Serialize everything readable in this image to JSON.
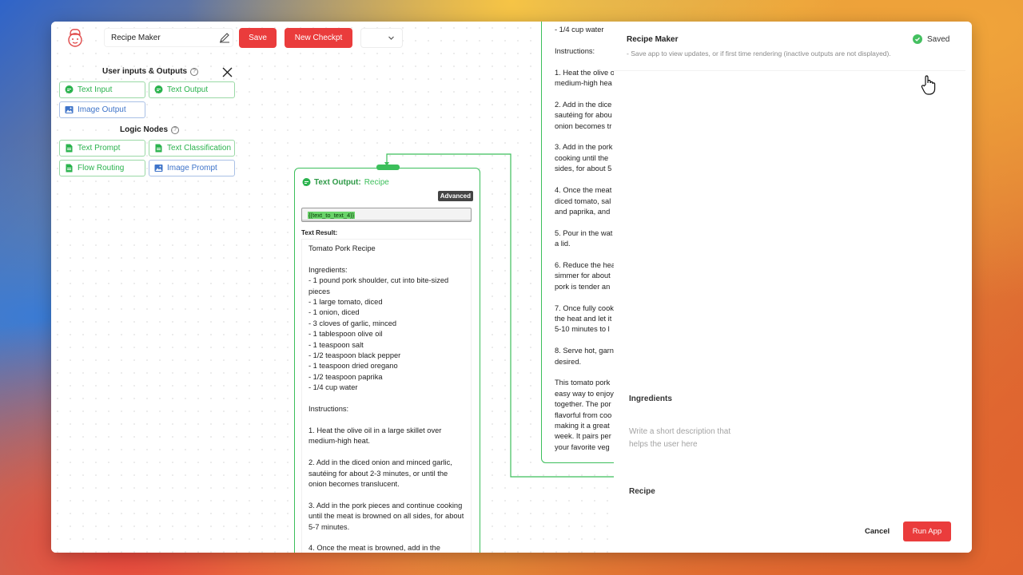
{
  "colors": {
    "accent_red": "#ea3c3c",
    "node_green": "#3cbf5b",
    "chip_green": "#2bb34e",
    "chip_blue": "#3f74c9"
  },
  "toolbar": {
    "app_name_value": "Recipe Maker",
    "save_label": "Save",
    "new_checkpoint_label": "New Checkpt",
    "dropdown_value": ""
  },
  "palette": {
    "io_title": "User inputs & Outputs",
    "io_items": [
      {
        "label": "Text Input",
        "icon": "chat-bubble-icon"
      },
      {
        "label": "Text Output",
        "icon": "chat-bubble-icon"
      },
      {
        "label": "Image Output",
        "icon": "image-icon"
      }
    ],
    "logic_title": "Logic Nodes",
    "logic_items": [
      {
        "label": "Text Prompt",
        "icon": "document-icon"
      },
      {
        "label": "Text Classification",
        "icon": "document-icon"
      },
      {
        "label": "Flow Routing",
        "icon": "document-icon"
      },
      {
        "label": "Image Prompt",
        "icon": "image-icon"
      }
    ]
  },
  "node": {
    "title": "Text Output:",
    "subtitle": "Recipe",
    "advanced_label": "Advanced",
    "variable": "{{text_to_text_4}}",
    "result_label": "Text Result:",
    "result_text": "Tomato Pork Recipe\n\nIngredients:\n- 1 pound pork shoulder, cut into bite-sized pieces\n- 1 large tomato, diced\n- 1 onion, diced\n- 3 cloves of garlic, minced\n- 1 tablespoon olive oil\n- 1 teaspoon salt\n- 1/2 teaspoon black pepper\n- 1 teaspoon dried oregano\n- 1/2 teaspoon paprika\n- 1/4 cup water\n\nInstructions:\n\n1. Heat the olive oil in a large skillet over medium-high heat.\n\n2. Add in the diced onion and minced garlic, sautéing for about 2-3 minutes, or until the onion becomes translucent.\n\n3. Add in the pork pieces and continue cooking until the meat is browned on all sides, for about 5-7 minutes.\n\n4. Once the meat is browned, add in the"
  },
  "node2": {
    "text": "- 1/4 cup water\n\nInstructions:\n\n1. Heat the olive o\nmedium-high hea\n\n2. Add in the dice\nsautéing for abou\nonion becomes tr\n\n3. Add in the pork\ncooking until the\nsides, for about 5\n\n4. Once the meat\ndiced tomato, sal\nand paprika, and\n\n5. Pour in the wat\na lid.\n\n6. Reduce the hea\nsimmer for about\npork is tender an\n\n7. Once fully cook\nthe heat and let it\n5-10 minutes to l\n\n8. Serve hot, garn\ndesired.\n\nThis tomato pork\neasy way to enjoy\ntogether. The por\nflavorful from coo\nmaking it a great\nweek. It pairs per\nyour favorite veg"
  },
  "panel": {
    "title": "Recipe Maker",
    "subtitle": "- Save app to view updates, or if first time rendering (inactive outputs are not displayed).",
    "saved_label": "Saved",
    "ingredients_label": "Ingredients",
    "description_placeholder": "Write a short description that helps the user here",
    "recipe_label": "Recipe",
    "cancel_label": "Cancel",
    "run_label": "Run App"
  }
}
